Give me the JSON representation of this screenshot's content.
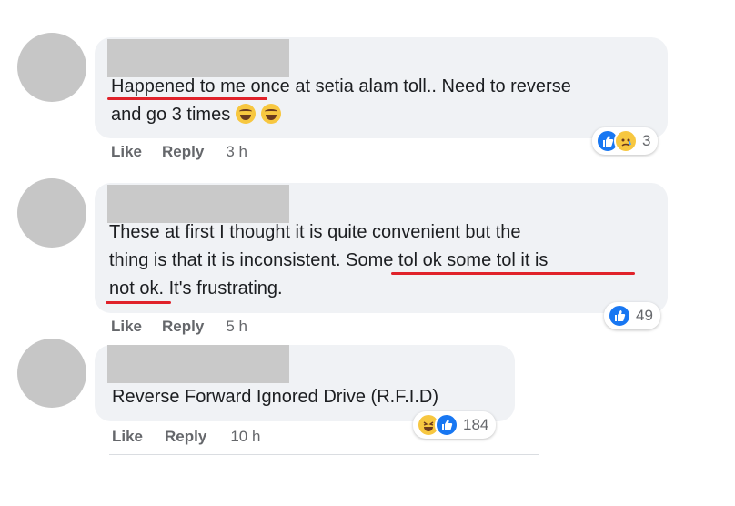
{
  "comments": [
    {
      "text_line1": "Happened to me once at setia alam toll.. Need to reverse",
      "text_line2": "and go 3 times",
      "like": "Like",
      "reply": "Reply",
      "time": "3 h",
      "reaction_count": "3",
      "reaction_icons": [
        "like-icon",
        "sad-icon"
      ]
    },
    {
      "text_line1": "These at first I thought it is quite convenient but the",
      "text_line2": "thing is that it is inconsistent. Some tol ok some tol it is",
      "text_line3": "not ok. It's frustrating.",
      "like": "Like",
      "reply": "Reply",
      "time": "5 h",
      "reaction_count": "49",
      "reaction_icons": [
        "like-icon"
      ]
    },
    {
      "text_line1": "Reverse Forward Ignored Drive (R.F.I.D)",
      "like": "Like",
      "reply": "Reply",
      "time": "10 h",
      "reaction_count": "184",
      "reaction_icons": [
        "laugh-icon",
        "like-icon"
      ]
    }
  ],
  "colors": {
    "bubble": "#f0f2f5",
    "meta_text": "#65676b",
    "like_blue": "#1877f2",
    "emoji_yellow": "#f7c740",
    "underline_red": "#e0222a",
    "redaction_gray": "#c9c9c9"
  }
}
